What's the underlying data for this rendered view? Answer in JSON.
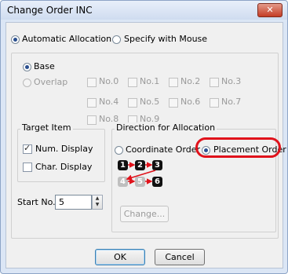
{
  "window": {
    "title": "Change Order INC",
    "close_label": "✕"
  },
  "allocation_mode": {
    "automatic_label": "Automatic Allocation",
    "mouse_label": "Specify with Mouse",
    "selected": "automatic"
  },
  "base_overlap": {
    "base_label": "Base",
    "overlap_label": "Overlap",
    "selected": "base"
  },
  "overlaps": [
    "No.0",
    "No.1",
    "No.2",
    "No.3",
    "No.4",
    "No.5",
    "No.6",
    "No.7",
    "No.8",
    "No.9"
  ],
  "target_item": {
    "title": "Target Item",
    "num_display": "Num. Display",
    "num_checked": true,
    "char_display": "Char. Display",
    "char_checked": false
  },
  "direction": {
    "title": "Direction for Allocation",
    "coordinate_label": "Coordinate Order",
    "placement_label": "Placement Order",
    "selected": "placement",
    "preview_numbers": [
      "1",
      "2",
      "3",
      "4",
      "5",
      "6"
    ],
    "change_label": "Change..."
  },
  "start_no": {
    "label": "Start No.",
    "value": "5"
  },
  "buttons": {
    "ok": "OK",
    "cancel": "Cancel"
  },
  "colors": {
    "highlight": "#e0121b",
    "arrow": "#e0121b"
  }
}
